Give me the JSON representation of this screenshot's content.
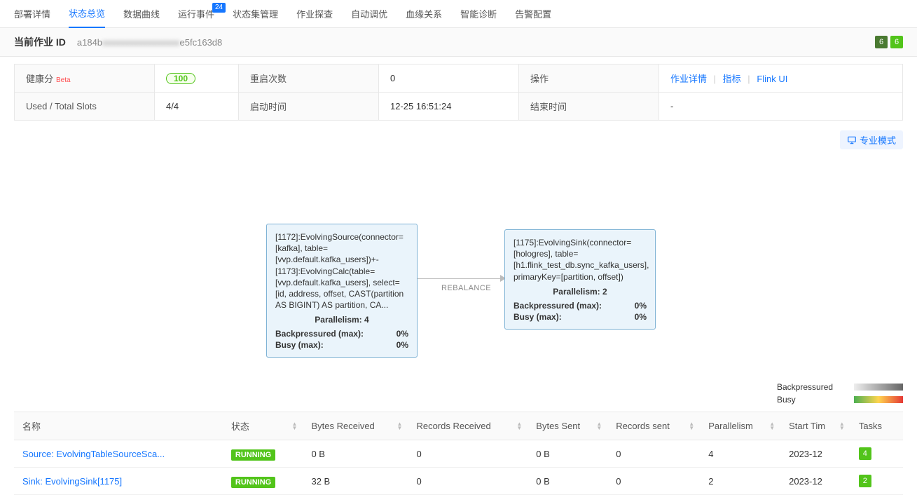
{
  "tabs": {
    "items": [
      {
        "label": "部署详情"
      },
      {
        "label": "状态总览"
      },
      {
        "label": "数据曲线"
      },
      {
        "label": "运行事件",
        "badge": "24"
      },
      {
        "label": "状态集管理"
      },
      {
        "label": "作业探查"
      },
      {
        "label": "自动调优"
      },
      {
        "label": "血缘关系"
      },
      {
        "label": "智能诊断"
      },
      {
        "label": "告警配置"
      }
    ],
    "active_index": 1
  },
  "job": {
    "id_label": "当前作业 ID",
    "id_prefix": "a184b",
    "id_masked": "xxxxxxxxxxxxxxxxx",
    "id_suffix": "e5fc163d8",
    "top_badges": [
      "6",
      "6"
    ]
  },
  "info": {
    "health_label": "健康分",
    "health_beta": "Beta",
    "health_score": "100",
    "restart_label": "重启次数",
    "restart_value": "0",
    "ops_label": "操作",
    "ops_links": [
      "作业详情",
      "指标",
      "Flink UI"
    ],
    "slots_label": "Used / Total Slots",
    "slots_value": "4/4",
    "start_label": "启动时间",
    "start_value": "12-25 16:51:24",
    "end_label": "结束时间",
    "end_value": "-"
  },
  "expert_btn": "专业模式",
  "graph": {
    "node1": {
      "desc": "[1172]:EvolvingSource(connector=[kafka], table=[vvp.default.kafka_users])+- [1173]:EvolvingCalc(table=[vvp.default.kafka_users], select=[id, address, offset, CAST(partition AS BIGINT) AS partition, CA...",
      "par": "Parallelism: 4",
      "bp_label": "Backpressured (max):",
      "bp_val": "0%",
      "busy_label": "Busy (max):",
      "busy_val": "0%"
    },
    "edge_label": "REBALANCE",
    "node2": {
      "desc": "[1175]:EvolvingSink(connector=[hologres], table=[h1.flink_test_db.sync_kafka_users], primaryKey=[partition, offset])",
      "par": "Parallelism: 2",
      "bp_label": "Backpressured (max):",
      "bp_val": "0%",
      "busy_label": "Busy (max):",
      "busy_val": "0%"
    },
    "legend": {
      "bp": "Backpressured",
      "busy": "Busy"
    }
  },
  "table": {
    "headers": [
      "名称",
      "状态",
      "Bytes Received",
      "Records Received",
      "Bytes Sent",
      "Records sent",
      "Parallelism",
      "Start Tim",
      "Tasks"
    ],
    "rows": [
      {
        "name": "Source: EvolvingTableSourceSca...",
        "status": "RUNNING",
        "bytes_recv": "0 B",
        "rec_recv": "0",
        "bytes_sent": "0 B",
        "rec_sent": "0",
        "par": "4",
        "start": "2023-12",
        "tasks": "4"
      },
      {
        "name": "Sink: EvolvingSink[1175]",
        "status": "RUNNING",
        "bytes_recv": "32 B",
        "rec_recv": "0",
        "bytes_sent": "0 B",
        "rec_sent": "0",
        "par": "2",
        "start": "2023-12",
        "tasks": "2"
      }
    ]
  }
}
